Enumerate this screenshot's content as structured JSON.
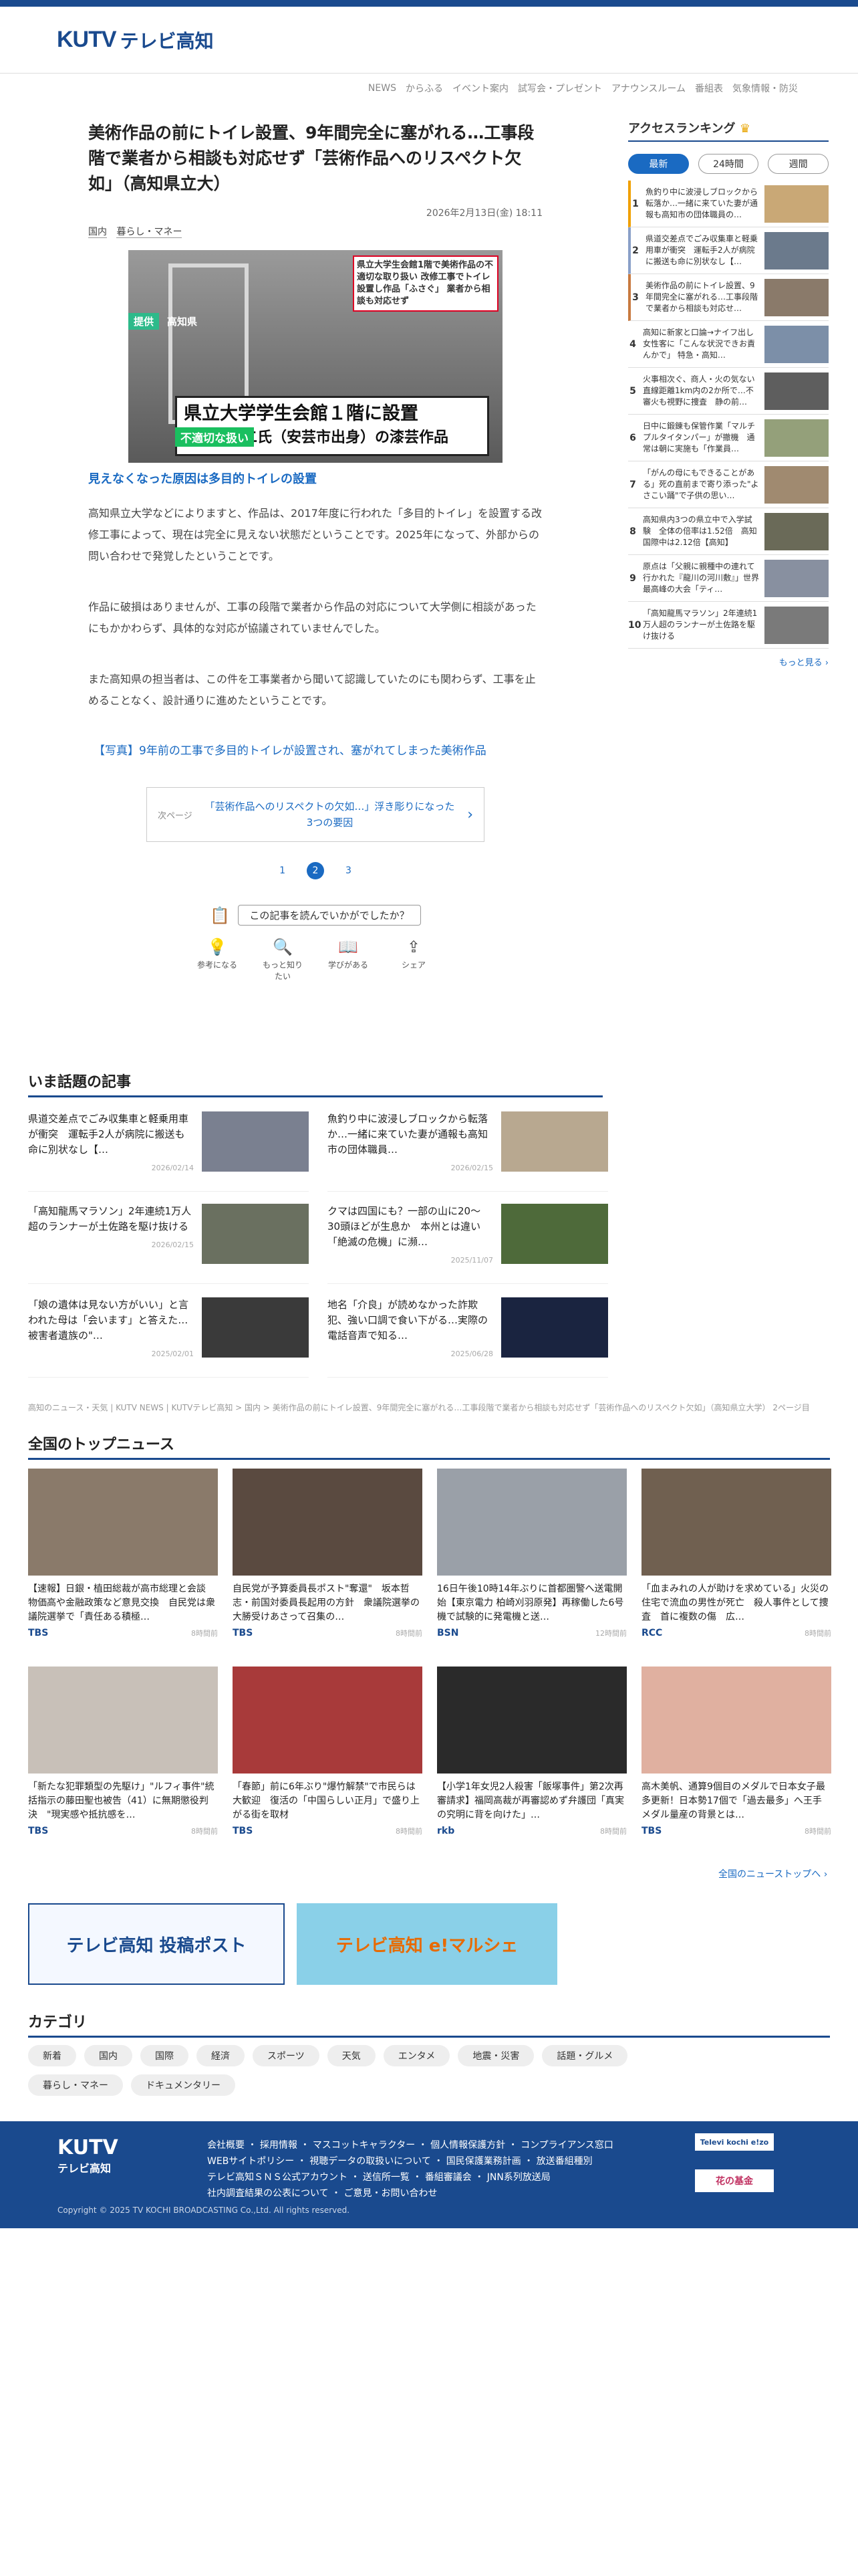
{
  "brand": {
    "logo_en": "KUTV",
    "logo_jp": "テレビ高知"
  },
  "nav": [
    "NEWS",
    "からふる",
    "イベント案内",
    "試写会・プレゼント",
    "アナウンスルーム",
    "番組表",
    "気象情報・防災"
  ],
  "article": {
    "title": "美術作品の前にトイレ設置、9年間完全に塞がれる…工事段階で業者から相談も対応せず「芸術作品へのリスペクト欠如」（高知県立大）",
    "date": "2026年2月13日(金) 18:11",
    "cats": [
      "国内",
      "暮らし・マネー"
    ],
    "image": {
      "caption_top": "県立大学生会館1階で美術作品の不適切な取り扱い 改修工事でトイレ設置し作品「ふさぐ」 業者から相談も対応せず",
      "tag": "不適切な扱い",
      "provider": "提供",
      "place": "高知県",
      "caption_main_1": "県立大学学生会館１階に設置",
      "caption_main_2": "吉田左源二氏（安芸市出身）の漆芸作品"
    },
    "subhead": "見えなくなった原因は多目的トイレの設置",
    "paras": [
      "高知県立大学などによりますと、作品は、2017年度に行われた「多目的トイレ」を設置する改修工事によって、現在は完全に見えない状態だということです。2025年になって、外部からの問い合わせで発覚したということです。",
      "作品に破損はありませんが、工事の段階で業者から作品の対応について大学側に相談があったにもかかわらず、具体的な対応が協議されていませんでした。",
      "また高知県の担当者は、この件を工事業者から聞いて認識していたのにも関わらず、工事を止めることなく、設計通りに進めたということです。"
    ],
    "photo_link": "【写真】9年前の工事で多目的トイレが設置され、塞がれてしまった美術作品",
    "next": {
      "label": "次ページ",
      "text": "「芸術作品へのリスペクトの欠如…」浮き彫りになった3つの要因"
    },
    "pages": [
      "1",
      "2",
      "3"
    ],
    "helpful_q": "この記事を読んでいかがでしたか？",
    "reactions": [
      {
        "icon": "bulb-icon",
        "label": "参考になる"
      },
      {
        "icon": "magnifier-icon",
        "label": "もっと知りたい"
      },
      {
        "icon": "book-icon",
        "label": "学びがある"
      },
      {
        "icon": "share-icon",
        "label": "シェア"
      }
    ]
  },
  "ranking": {
    "title": "アクセスランキング",
    "tabs": [
      "最新",
      "24時間",
      "週間"
    ],
    "items": [
      {
        "n": "1",
        "t": "魚釣り中に波浸しブロックから転落か…一緒に来ていた妻が通報も高知市の団体職員の…"
      },
      {
        "n": "2",
        "t": "県道交差点でごみ収集車と軽乗用車が衝突　運転手2人が病院に搬送も命に別状なし【…"
      },
      {
        "n": "3",
        "t": "美術作品の前にトイレ設置、9年間完全に塞がれる…工事段階で業者から相談も対応せ…"
      },
      {
        "n": "4",
        "t": "高知に新家と口論→ナイフ出し女性客に「こんな状況できお責んかで」 特急・高知…"
      },
      {
        "n": "5",
        "t": "火事相次ぐ、商人・火の気ない直線距離1km内の2か所で…不審火も視野に捜査　静の前…"
      },
      {
        "n": "6",
        "t": "日中に鍛錬も保管作業「マルチプルタイタンパー」が撤機　通常は朝に実施も「作業員…"
      },
      {
        "n": "7",
        "t": "「がんの母にもできることがある」死の直前まで寄り添った\"よさこい踊\"で子供の思い…"
      },
      {
        "n": "8",
        "t": "高知県内3つの県立中で入学試験　全体の倍率は1.52倍　高知国際中は2.12倍【高知】"
      },
      {
        "n": "9",
        "t": "原点は「父親に親種中の連れて行かれた『龍川の河川敷』」世界最高峰の大会「ティ…"
      },
      {
        "n": "10",
        "t": "「高知龍馬マラソン」2年連続1万人超のランナーが土佐路を駆け抜ける"
      }
    ],
    "more": "もっと見る ›"
  },
  "topics": {
    "title": "いま話題の記事",
    "items": [
      {
        "t": "県道交差点でごみ収集車と軽乗用車が衝突　運転手2人が病院に搬送も命に別状なし【…",
        "d": "2026/02/14"
      },
      {
        "t": "魚釣り中に波浸しブロックから転落か…一緒に来ていた妻が通報も高知市の団体職員…",
        "d": "2026/02/15"
      },
      {
        "t": "「高知龍馬マラソン」2年連続1万人超のランナーが土佐路を駆け抜ける",
        "d": "2026/02/15"
      },
      {
        "t": "クマは四国にも？一部の山に20〜30頭ほどが生息か　本州とは違い「絶滅の危機」に瀕…",
        "d": "2025/11/07"
      },
      {
        "t": "「娘の遺体は見ない方がいい」と言われた母は「会います」と答えた…被害者遺族の\"…",
        "d": "2025/02/01"
      },
      {
        "t": "地名「介良」が読めなかった詐欺犯、強い口調で食い下がる…実際の電話音声で知る…",
        "d": "2025/06/28"
      }
    ]
  },
  "breadcrumb": "高知のニュース・天気 | KUTV NEWS | KUTVテレビ高知 > 国内 > 美術作品の前にトイレ設置、9年間完全に塞がれる…工事段階で業者から相談も対応せず「芸術作品へのリスペクト欠如」（高知県立大学） 2ページ目",
  "national": {
    "title": "全国のトップニュース",
    "items": [
      {
        "t": "【速報】日銀・植田総裁が高市総理と会談　物価高や金融政策など意見交換　自民党は衆議院選挙で「責任ある積極…",
        "src": "TBS",
        "ago": "8時間前"
      },
      {
        "t": "自民党が予算委員長ポスト\"奪還\"　坂本哲志・前国対委員長起用の方針　衆議院選挙の大勝受けあさって召集の…",
        "src": "TBS",
        "ago": "8時間前"
      },
      {
        "t": "16日午後10時14年ぶりに首都圏警へ送電開始【東京電力 柏崎刈羽原発】再稼働した6号機で試験的に発電機と送…",
        "src": "BSN",
        "ago": "12時間前"
      },
      {
        "t": "「血まみれの人が助けを求めている」火災の住宅で流血の男性が死亡　殺人事件として捜査　首に複数の傷　広…",
        "src": "RCC",
        "ago": "8時間前"
      },
      {
        "t": "「新たな犯罪類型の先駆け」\"ルフィ事件\"統括指示の藤田聖也被告（41）に無期懲役判決　\"現実感や抵抗感を…",
        "src": "TBS",
        "ago": "8時間前"
      },
      {
        "t": "「春節」前に6年ぶり\"爆竹解禁\"で市民らは大歓迎　復活の「中国らしい正月」で盛り上がる街を取材",
        "src": "TBS",
        "ago": "8時間前"
      },
      {
        "t": "【小学1年女児2人殺害「飯塚事件」第2次再審請求】福岡高裁が再審認めず弁護団「真実の究明に背を向けた」…",
        "src": "rkb",
        "ago": "8時間前"
      },
      {
        "t": "高木美帆、通算9個目のメダルで日本女子最多更新！日本勢17個で「過去最多」へ王手　メダル量産の背景とは…",
        "src": "TBS",
        "ago": "8時間前"
      }
    ],
    "more": "全国のニューストップへ ›"
  },
  "banners": [
    {
      "t": "テレビ高知 投稿ポスト"
    },
    {
      "t": "テレビ高知 e!マルシェ"
    }
  ],
  "categories": {
    "title": "カテゴリ",
    "items": [
      "新着",
      "国内",
      "国際",
      "経済",
      "スポーツ",
      "天気",
      "エンタメ",
      "地震・災害",
      "話題・グルメ",
      "暮らし・マネー",
      "ドキュメンタリー"
    ]
  },
  "footer": {
    "links": [
      "会社概要",
      "採用情報",
      "マスコットキャラクター",
      "個人情報保護方針",
      "コンプライアンス窓口",
      "WEBサイトポリシー",
      "視聴データの取扱いについて",
      "国民保護業務計画",
      "放送番組種別",
      "テレビ高知ＳＮＳ公式アカウント",
      "送信所一覧",
      "番組審議会",
      "JNN系列放送局",
      "社内調査結果の公表について",
      "ご意見・お問い合わせ"
    ],
    "copyright": "Copyright © 2025 TV KOCHI BROADCASTING Co.,Ltd. All rights reserved.",
    "partner1": "Televi kochi e!zo",
    "partner2": "花の基金"
  }
}
